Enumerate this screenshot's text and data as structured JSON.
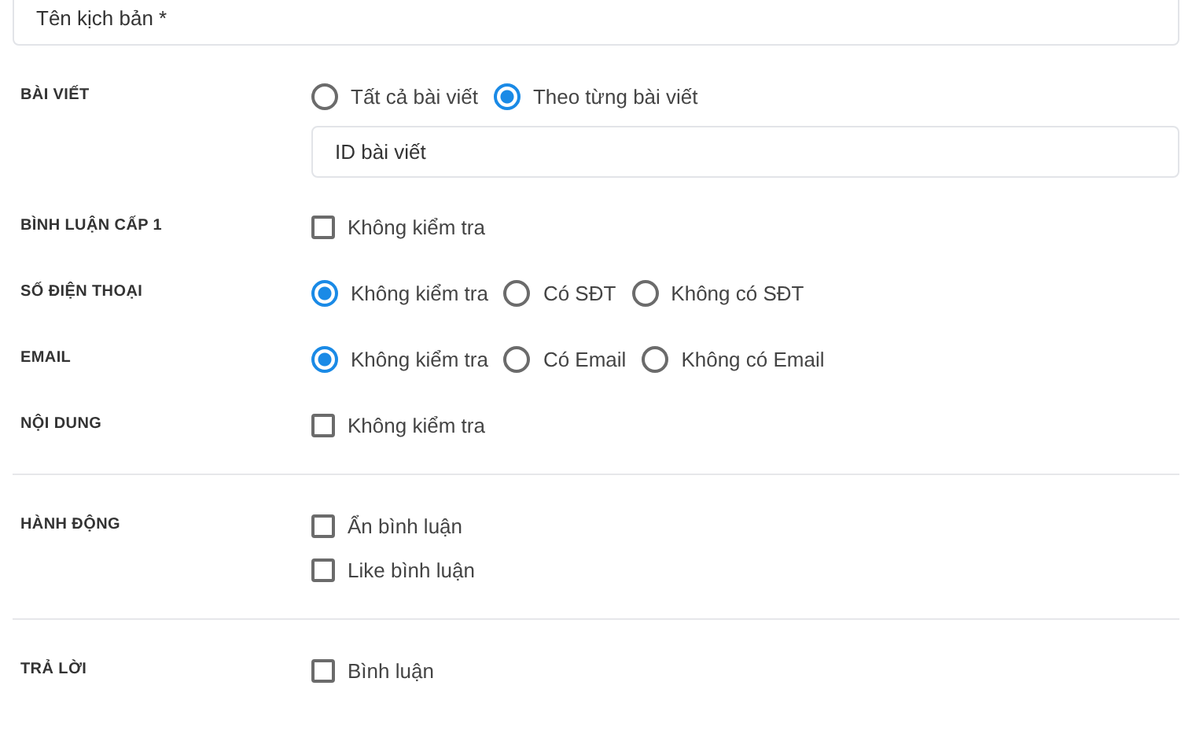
{
  "name_field": {
    "placeholder": "Tên kịch bản *"
  },
  "groups": [
    {
      "rows": [
        {
          "label": "BÀI VIẾT",
          "kind": "radio",
          "options": [
            {
              "label": "Tất cả bài viết",
              "selected": false
            },
            {
              "label": "Theo từng bài viết",
              "selected": true
            }
          ],
          "field": {
            "placeholder": "ID bài viết"
          }
        },
        {
          "label": "BÌNH LUẬN CẤP 1",
          "kind": "checkbox",
          "options": [
            {
              "label": "Không kiểm tra",
              "checked": false
            }
          ]
        },
        {
          "label": "SỐ ĐIỆN THOẠI",
          "kind": "radio",
          "options": [
            {
              "label": "Không kiểm tra",
              "selected": true
            },
            {
              "label": "Có SĐT",
              "selected": false
            },
            {
              "label": "Không có SĐT",
              "selected": false
            }
          ]
        },
        {
          "label": "EMAIL",
          "kind": "radio",
          "options": [
            {
              "label": "Không kiểm tra",
              "selected": true
            },
            {
              "label": "Có Email",
              "selected": false
            },
            {
              "label": "Không có Email",
              "selected": false
            }
          ]
        },
        {
          "label": "NỘI DUNG",
          "kind": "checkbox",
          "options": [
            {
              "label": "Không kiểm tra",
              "checked": false
            }
          ]
        }
      ]
    },
    {
      "rows": [
        {
          "label": "HÀNH ĐỘNG",
          "kind": "checkbox",
          "options": [
            {
              "label": "Ẩn bình luận",
              "checked": false
            },
            {
              "label": "Like bình luận",
              "checked": false
            }
          ]
        }
      ]
    },
    {
      "rows": [
        {
          "label": "TRẢ LỜI",
          "kind": "checkbox",
          "options": [
            {
              "label": "Bình luận",
              "checked": false
            }
          ]
        }
      ]
    }
  ]
}
